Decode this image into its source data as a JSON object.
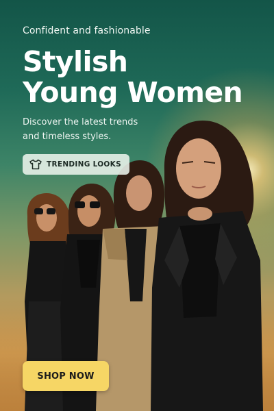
{
  "banner": {
    "eyebrow": "Confident and fashionable",
    "headline_line1": "Stylish",
    "headline_line2": "Young Women",
    "subtitle_line1": "Discover the latest trends",
    "subtitle_line2": "and timeless styles.",
    "chip": {
      "icon": "tshirt-icon",
      "label": "TRENDING LOOKS"
    },
    "cta_label": "SHOP NOW"
  },
  "colors": {
    "background_top": "#135548",
    "background_bottom": "#b07a3b",
    "sun_glow": "#ffe9b8",
    "chip_background": "#ecf4ec",
    "cta_background": "#f6d665",
    "cta_text": "#1a1a1a",
    "text": "#ffffff"
  }
}
